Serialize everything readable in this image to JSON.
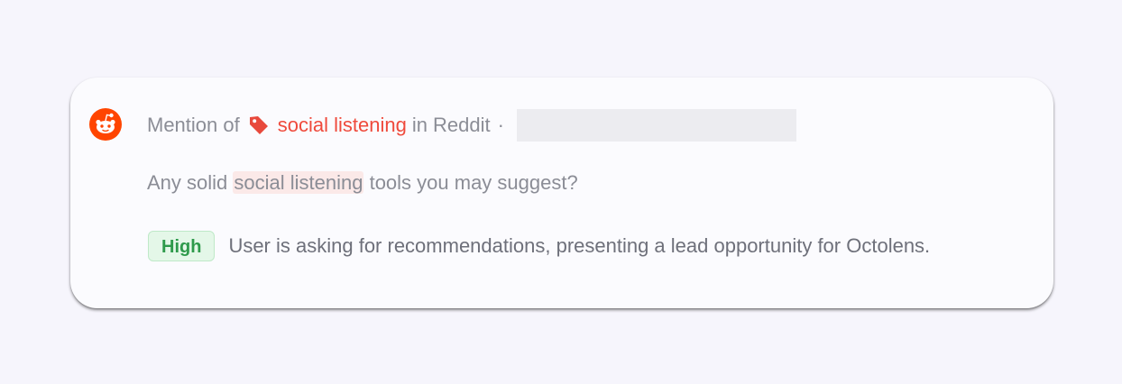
{
  "mention": {
    "prefix": "Mention of",
    "keyword": "social listening",
    "source_text": "in Reddit",
    "separator": "·",
    "platform_icon": "reddit-icon",
    "keyword_icon": "tag-icon"
  },
  "message": {
    "before": "Any solid ",
    "highlight": "social listening",
    "after": " tools you may suggest?"
  },
  "insight": {
    "priority": "High",
    "summary": "User is asking for recommendations, presenting a lead opportunity for Octolens."
  },
  "colors": {
    "keyword": "#ef4a3c",
    "reddit": "#ff4500",
    "badge_text": "#2e9a4b",
    "badge_bg": "#e4f7e8"
  }
}
